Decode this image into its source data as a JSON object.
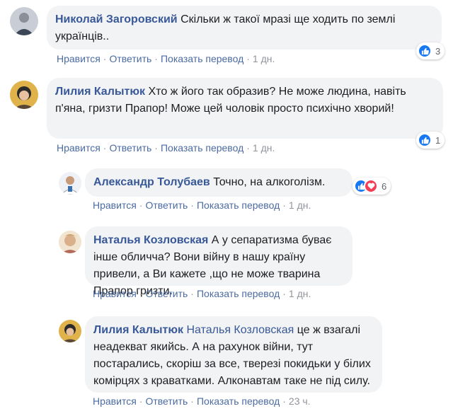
{
  "comments": [
    {
      "author": "Николай Загоровский",
      "text": "Скільки ж такої мразі ще ходить по землі українців..",
      "reactions": {
        "count": "3",
        "types": [
          "like-icon"
        ]
      },
      "actions": {
        "like": "Нравится",
        "reply": "Ответить",
        "translate": "Показать перевод",
        "time": "1 дн."
      }
    },
    {
      "author": "Лилия Калытюк",
      "text": "Хто ж його так образив? Не може людина, навіть п'яна, гризти Прапор! Може цей чоловік просто психічно хворий!",
      "reactions": {
        "count": "1",
        "types": [
          "like-icon"
        ]
      },
      "actions": {
        "like": "Нравится",
        "reply": "Ответить",
        "translate": "Показать перевод",
        "time": "1 дн."
      },
      "replies": [
        {
          "author": "Александр Толубаев",
          "text": "Точно, на алкоголізм.",
          "reactions": {
            "count": "6",
            "types": [
              "like-icon",
              "love-icon"
            ]
          },
          "actions": {
            "like": "Нравится",
            "reply": "Ответить",
            "translate": "Показать перевод",
            "time": "1 дн."
          }
        },
        {
          "author": "Наталья Козловская",
          "text": "А у сепаратизма буває інше обличча? Вони війну в нашу країну привели, а Ви кажете ,що не може тварина Прапор гризти.",
          "actions": {
            "like": "Нравится",
            "reply": "Ответить",
            "translate": "Показать перевод",
            "time": "1 дн."
          }
        },
        {
          "author": "Лилия Калытюк",
          "mention": "Наталья Козловская",
          "text": "це ж взагалі неадекват якийсь. А на рахунок війни, тут постарались, скоріш за все, тверезі покидьки у білих комірцях з краватками. Алконавтам таке не під силу.",
          "actions": {
            "like": "Нравится",
            "reply": "Ответить",
            "translate": "Показать перевод",
            "time": "23 ч."
          }
        }
      ]
    }
  ],
  "colors": {
    "link": "#385898",
    "bubble": "#f2f3f5",
    "like": "#1877f2",
    "love": "#f33e58"
  }
}
